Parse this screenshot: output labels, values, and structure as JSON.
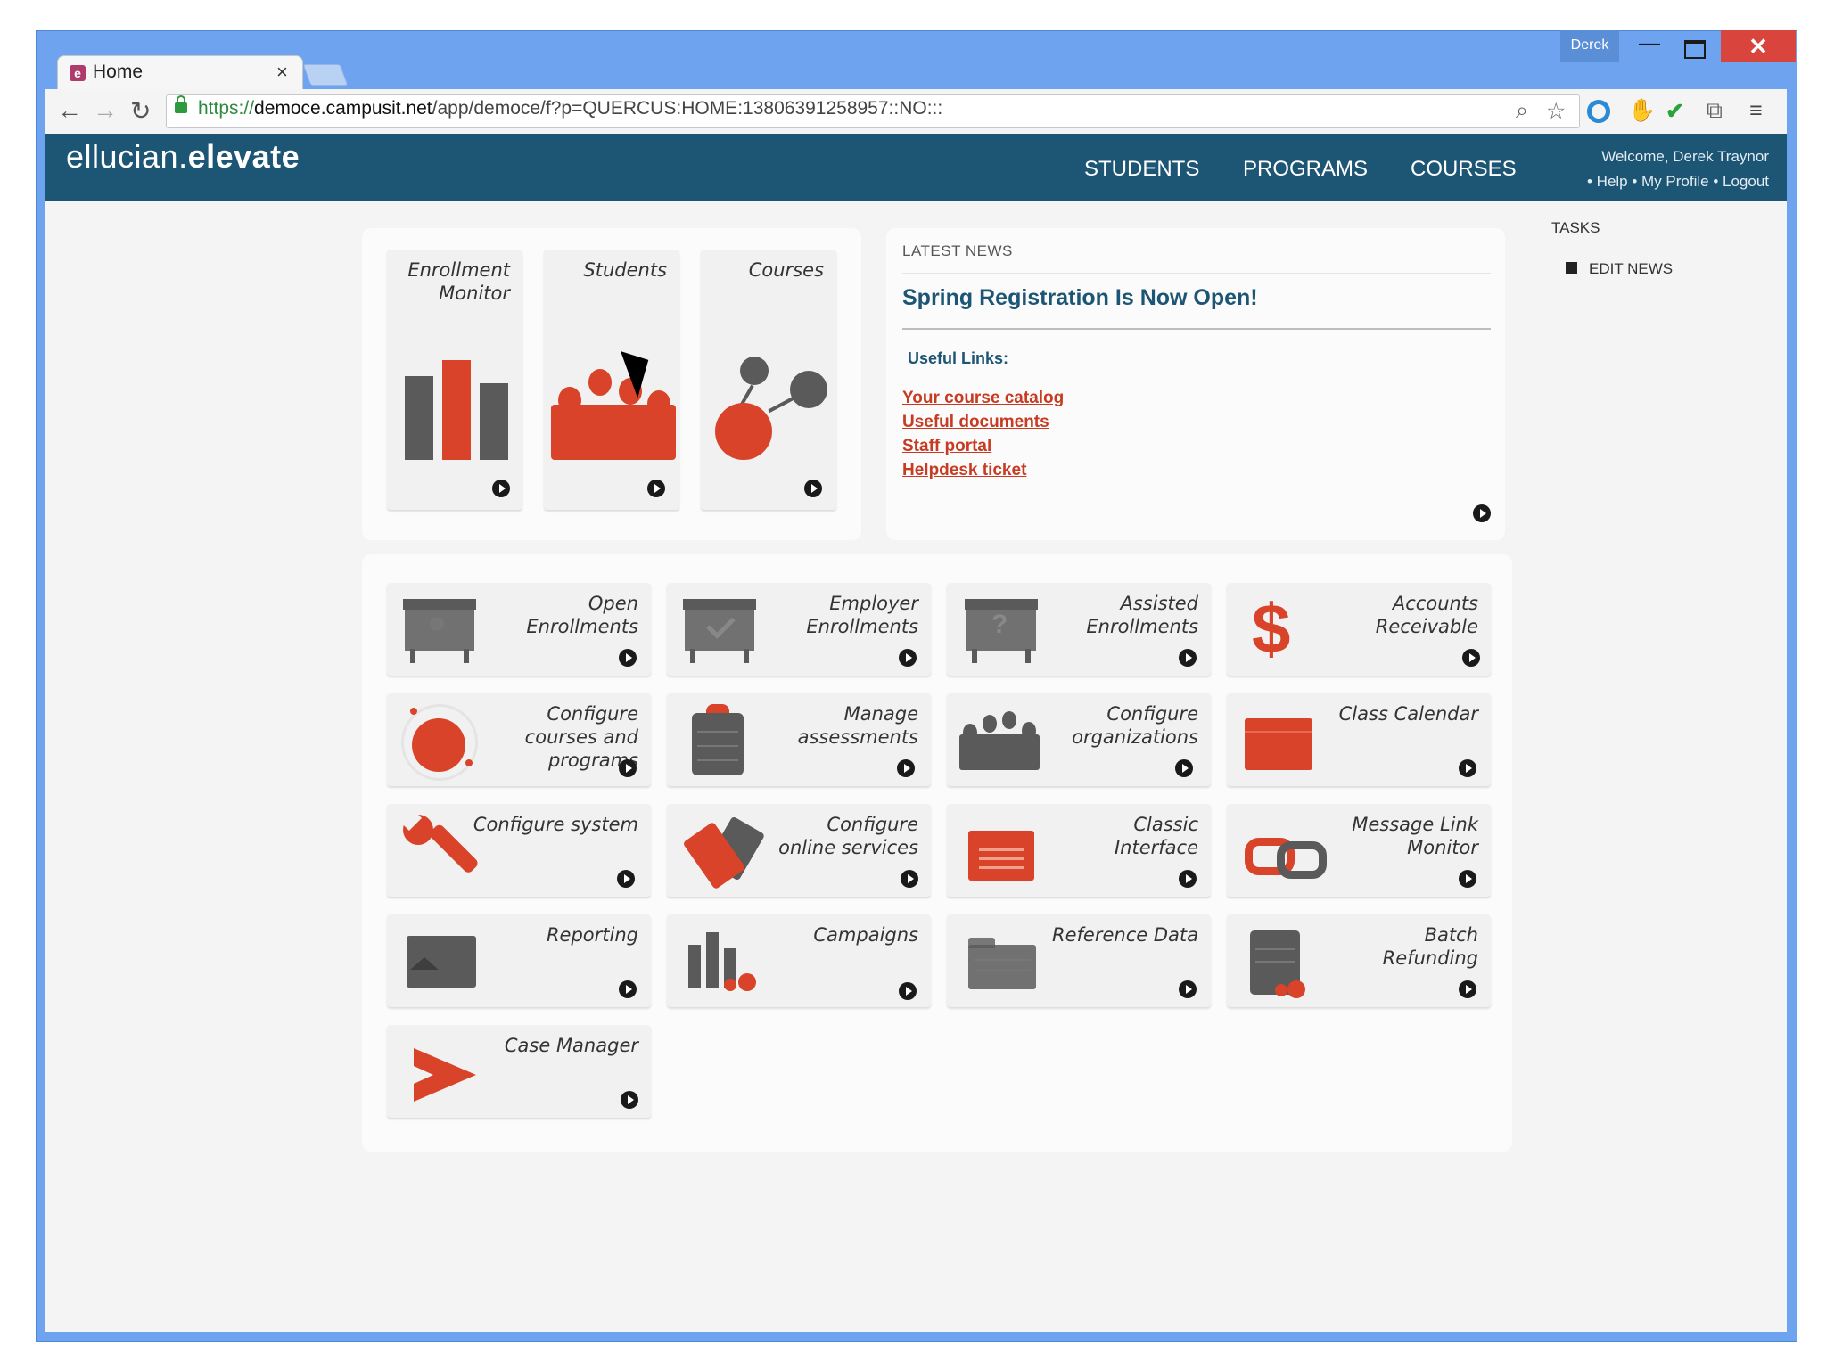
{
  "browser": {
    "tab_title": "Home",
    "tab_close": "×",
    "window_user": "Derek",
    "window_min": "—",
    "window_close": "✕",
    "url_scheme": "https://",
    "url_host": "democe.campusit.net",
    "url_path": "/app/democe/f?p=QUERCUS:HOME:13806391258957::NO:::"
  },
  "app": {
    "logo_light": "ellucian.",
    "logo_bold": "elevate",
    "nav": [
      "STUDENTS",
      "PROGRAMS",
      "COURSES"
    ],
    "welcome": "Welcome, Derek Traynor",
    "user_links": "• Help • My Profile • Logout"
  },
  "summary_cards": [
    {
      "label": "Enrollment Monitor",
      "icon": "bar-chart-icon"
    },
    {
      "label": "Students",
      "icon": "students-crowd-icon"
    },
    {
      "label": "Courses",
      "icon": "courses-network-icon"
    }
  ],
  "news": {
    "header": "LATEST NEWS",
    "title": "Spring Registration Is Now Open!",
    "useful_links_label": "Useful Links:",
    "links": [
      "Your course catalog",
      "Useful documents",
      "Staff portal",
      "Helpdesk ticket"
    ]
  },
  "tasks": {
    "header": "TASKS",
    "items": [
      "EDIT NEWS"
    ]
  },
  "tiles": [
    {
      "label": "Open Enrollments",
      "icon": "whiteboard-person-icon"
    },
    {
      "label": "Employer Enrollments",
      "icon": "whiteboard-check-icon"
    },
    {
      "label": "Assisted Enrollments",
      "icon": "whiteboard-question-icon"
    },
    {
      "label": "Accounts Receivable",
      "icon": "dollar-icon"
    },
    {
      "label": "Configure courses and programs",
      "icon": "configure-circle-icon"
    },
    {
      "label": "Manage assessments",
      "icon": "clipboard-icon"
    },
    {
      "label": "Configure organizations",
      "icon": "organization-icon"
    },
    {
      "label": "Class Calendar",
      "icon": "calendar-icon"
    },
    {
      "label": "Configure system",
      "icon": "wrench-icon"
    },
    {
      "label": "Configure online services",
      "icon": "online-services-icon"
    },
    {
      "label": "Classic Interface",
      "icon": "classic-window-icon"
    },
    {
      "label": "Message Link Monitor",
      "icon": "chain-link-icon"
    },
    {
      "label": "Reporting",
      "icon": "reporting-chart-icon"
    },
    {
      "label": "Campaigns",
      "icon": "campaigns-chart-icon"
    },
    {
      "label": "Reference Data",
      "icon": "folder-icon"
    },
    {
      "label": "Batch Refunding",
      "icon": "batch-refund-icon"
    },
    {
      "label": "Case Manager",
      "icon": "arrow-play-icon"
    }
  ],
  "colors": {
    "brand": "#1d5574",
    "accent": "#d8432a",
    "icon_grey": "#5a5a5a"
  }
}
